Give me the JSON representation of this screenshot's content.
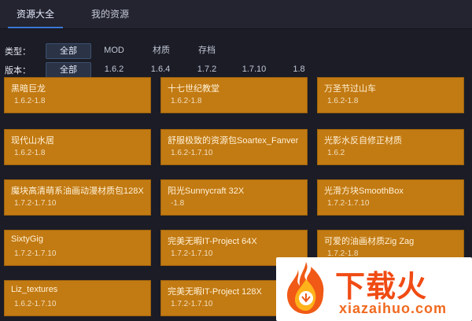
{
  "tabs": [
    {
      "label": "资源大全",
      "active": true
    },
    {
      "label": "我的资源",
      "active": false
    }
  ],
  "filters": {
    "type": {
      "label": "类型：",
      "options": [
        "全部",
        "MOD",
        "材质",
        "存档"
      ],
      "selected": "全部"
    },
    "version": {
      "label": "版本：",
      "options": [
        "全部",
        "1.6.2",
        "1.6.4",
        "1.7.2",
        "1.7.10",
        "1.8"
      ],
      "selected": "全部"
    }
  },
  "resources": [
    {
      "title": "黑暗巨龙",
      "version": "1.6.2-1.8"
    },
    {
      "title": "十七世纪教堂",
      "version": "1.6.2-1.8"
    },
    {
      "title": "万圣节过山车",
      "version": "1.6.2-1.8"
    },
    {
      "title": "现代山水居",
      "version": "1.6.2-1.8"
    },
    {
      "title": "舒服极致的资源包Soartex_Fanver",
      "version": "1.6.2-1.7.10"
    },
    {
      "title": "光影水反自修正材质",
      "version": "1.6.2"
    },
    {
      "title": "魔块高清萌系油画动漫材质包128X",
      "version": "1.7.2-1.7.10"
    },
    {
      "title": "阳光Sunnycraft 32X",
      "version": "-1.8"
    },
    {
      "title": "光滑方块SmoothBox",
      "version": "1.7.2-1.7.10"
    },
    {
      "title": "SixtyGig",
      "version": "1.7.2-1.7.10"
    },
    {
      "title": "完美无暇IT-Project 64X",
      "version": "1.7.2-1.7.10"
    },
    {
      "title": "可爱的油画材质Zig Zag",
      "version": "1.7.2-1.8"
    },
    {
      "title": "Liz_textures",
      "version": "1.6.2-1.7.10"
    },
    {
      "title": "完美无暇IT-Project 128X",
      "version": "1.7.2-1.7.10"
    }
  ],
  "watermark": {
    "brand": "下载火",
    "site": "xiazaihuo.com",
    "icon": "flame-logo-icon",
    "color": "#f04b14"
  },
  "colors": {
    "card": "#c27a12",
    "background": "#1b1c25",
    "accent": "#3a78d6"
  }
}
